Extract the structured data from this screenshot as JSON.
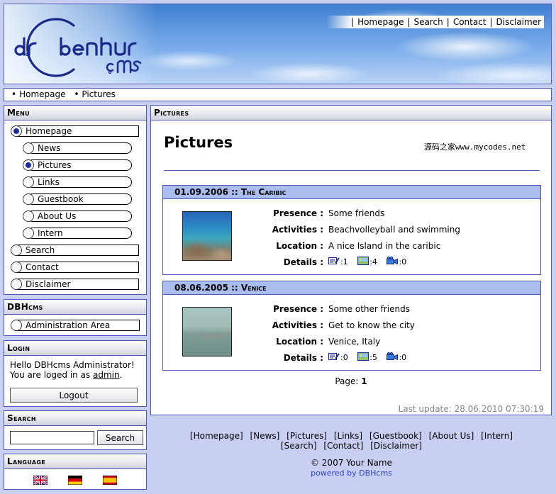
{
  "header": {
    "logo_text": "dr.benhur .cms",
    "nav": [
      "Homepage",
      "Search",
      "Contact",
      "Disclaimer"
    ]
  },
  "breadcrumb": [
    "Homepage",
    "Pictures"
  ],
  "menu": {
    "title": "Menu",
    "items": [
      {
        "label": "Homepage",
        "selected": true,
        "sub": false
      },
      {
        "label": "News",
        "selected": false,
        "sub": true
      },
      {
        "label": "Pictures",
        "selected": true,
        "sub": true
      },
      {
        "label": "Links",
        "selected": false,
        "sub": true
      },
      {
        "label": "Guestbook",
        "selected": false,
        "sub": true
      },
      {
        "label": "About Us",
        "selected": false,
        "sub": true
      },
      {
        "label": "Intern",
        "selected": false,
        "sub": true
      },
      {
        "label": "Search",
        "selected": false,
        "sub": false
      },
      {
        "label": "Contact",
        "selected": false,
        "sub": false
      },
      {
        "label": "Disclaimer",
        "selected": false,
        "sub": false
      }
    ]
  },
  "dbhcms": {
    "title": "DBHcms",
    "item": "Administration Area"
  },
  "login": {
    "title": "Login",
    "line1": "Hello DBHcms Administrator!",
    "line2_prefix": "You are loged in as ",
    "user": "admin",
    "line2_suffix": ".",
    "logout_label": "Logout"
  },
  "search": {
    "title": "Search",
    "value": "",
    "button_label": "Search"
  },
  "language": {
    "title": "Language",
    "flags": [
      "flag-uk-icon",
      "flag-germany-icon",
      "flag-spain-icon"
    ]
  },
  "main": {
    "bar_title": "Pictures",
    "heading": "Pictures",
    "watermark": "源码之家www.mycodes.net",
    "entries": [
      {
        "date": "01.09.2006",
        "sep": " :: ",
        "title": "The Caribic",
        "fields": [
          {
            "key": "Presence :",
            "value": "Some friends"
          },
          {
            "key": "Activities :",
            "value": "Beachvolleyball and swimming"
          },
          {
            "key": "Location :",
            "value": "A nice Island in the caribic"
          }
        ],
        "details_key": "Details :",
        "details": [
          ":1",
          ":4",
          ":0"
        ]
      },
      {
        "date": "08.06.2005",
        "sep": " :: ",
        "title": "Venice",
        "fields": [
          {
            "key": "Presence :",
            "value": "Some other friends"
          },
          {
            "key": "Activities :",
            "value": "Get to know the city"
          },
          {
            "key": "Location :",
            "value": "Venice, Italy"
          }
        ],
        "details_key": "Details :",
        "details": [
          ":0",
          ":5",
          ":0"
        ]
      }
    ],
    "page_label": "Page:",
    "page_number": "1",
    "last_update": "Last update: 28.06.2010 07:30:19"
  },
  "footer": {
    "links": [
      "[Homepage]",
      "[News]",
      "[Pictures]",
      "[Links]",
      "[Guestbook]",
      "[About Us]",
      "[Intern]",
      "[Search]",
      "[Contact]",
      "[Disclaimer]"
    ],
    "copyright": "© 2007 Your Name",
    "powered": "powered by DBHcms"
  },
  "colors": {
    "accent": "#4c59b6",
    "page_bg": "#c8cff2",
    "entry_head": "#aabdef",
    "link_blue": "#3344cc",
    "muted": "#888888"
  }
}
